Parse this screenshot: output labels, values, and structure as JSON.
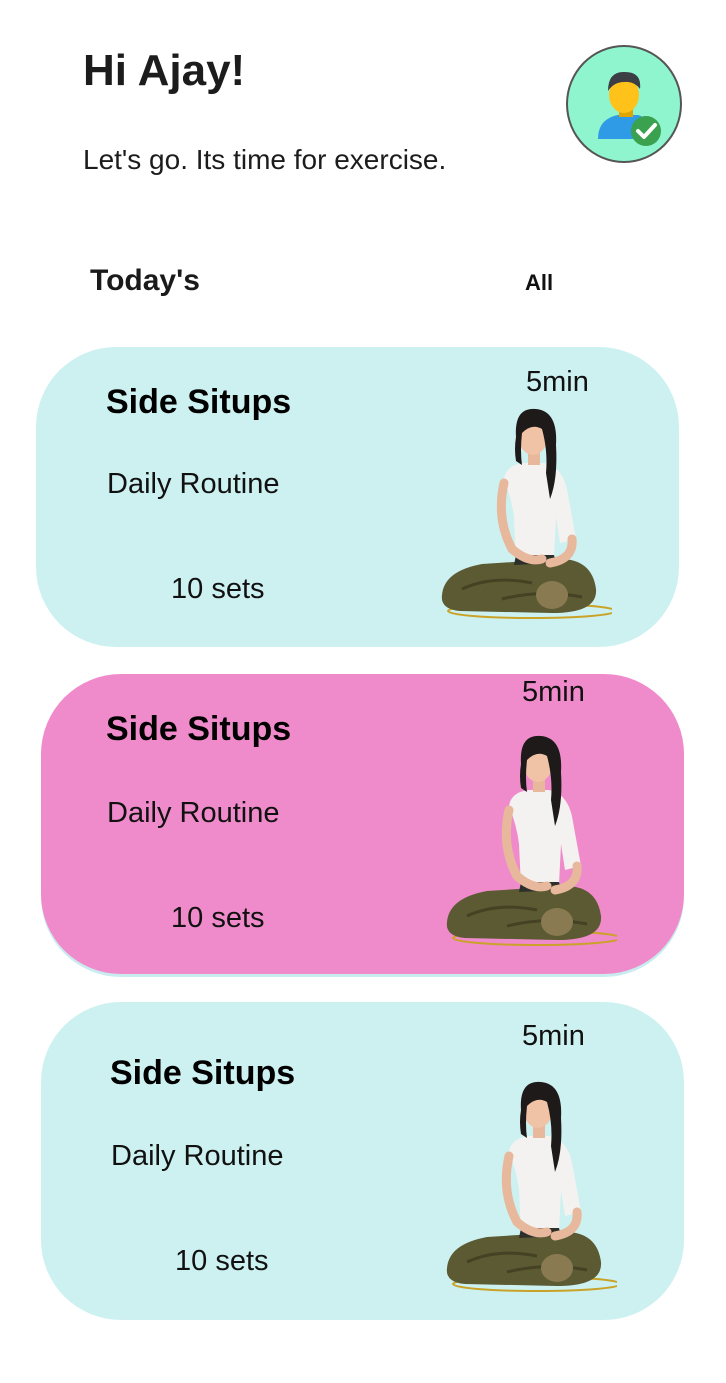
{
  "header": {
    "greeting": "Hi Ajay!",
    "subtitle": "Let's go. Its time for exercise.",
    "avatar_icon": "verified-user-icon"
  },
  "section": {
    "title": "Today's",
    "link_label": "All"
  },
  "colors": {
    "card_teal": "#cdf1f1",
    "card_pink": "#f08bcb",
    "avatar_bg": "#8ef5cf"
  },
  "workouts": [
    {
      "title": "Side Situps",
      "subtitle": "Daily Routine",
      "sets": "10 sets",
      "duration": "5min",
      "color": "#cdf1f1",
      "image": "meditating-woman-image"
    },
    {
      "title": "Side Situps",
      "subtitle": "Daily Routine",
      "sets": "10 sets",
      "duration": "5min",
      "color": "#f08bcb",
      "image": "meditating-woman-image"
    },
    {
      "title": "Side Situps",
      "subtitle": "Daily Routine",
      "sets": "10 sets",
      "duration": "5min",
      "color": "#cdf1f1",
      "image": "meditating-woman-image"
    }
  ]
}
